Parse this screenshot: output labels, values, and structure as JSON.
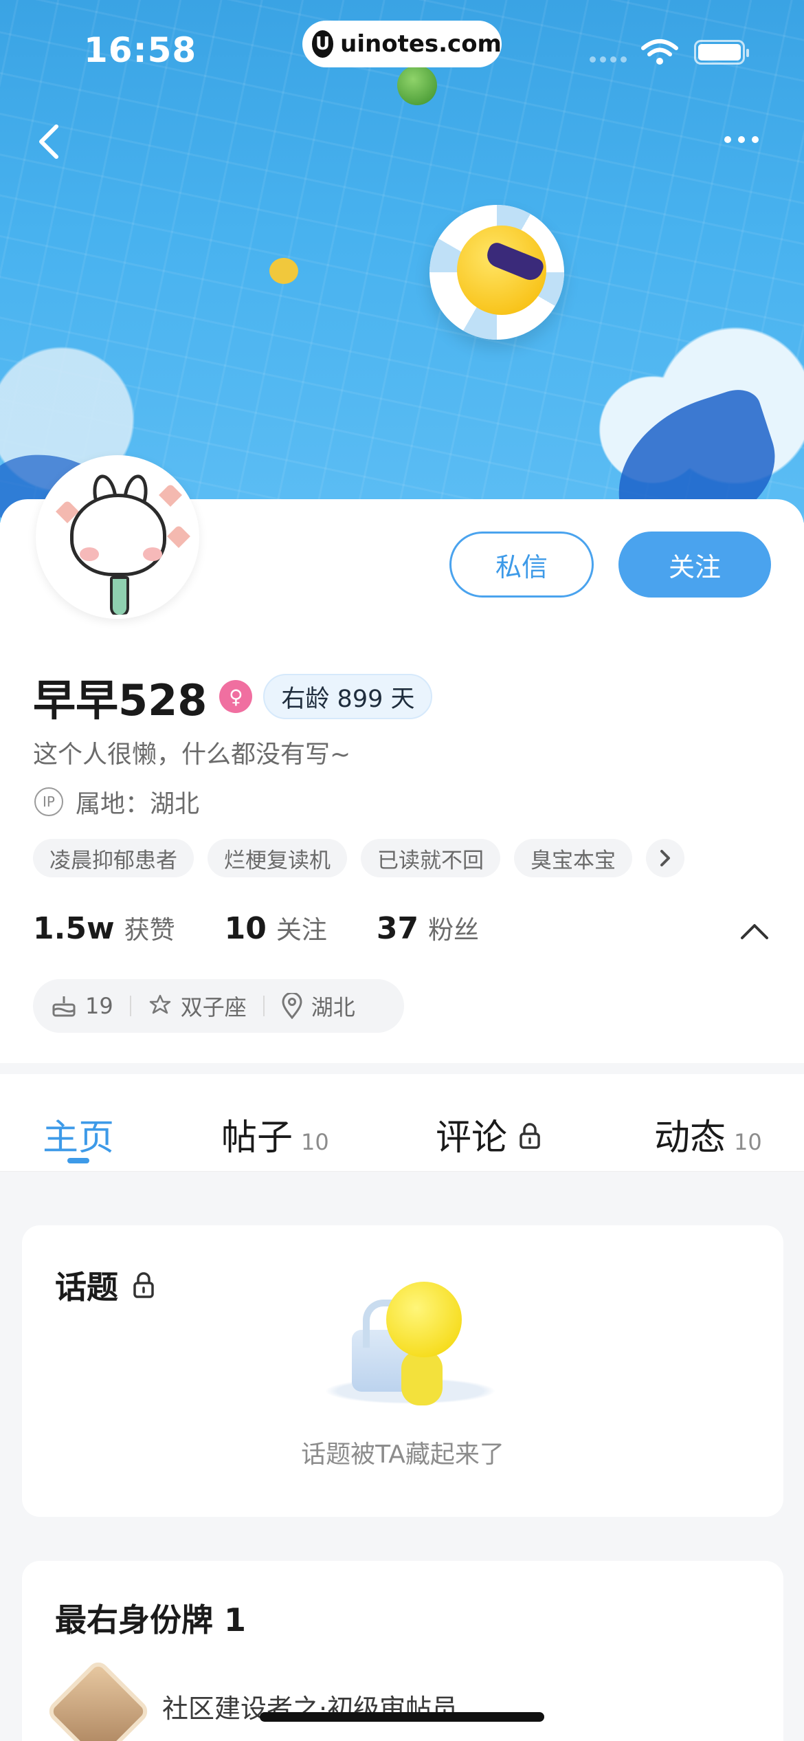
{
  "status_bar": {
    "time": "16:58",
    "url": "uinotes.com",
    "url_icon": "U"
  },
  "profile": {
    "username": "早早528",
    "gender_badge": "♀",
    "account_age": "右龄 899 天",
    "bio": "这个人很懒，什么都没有写~",
    "ip_icon_text": "IP",
    "ip_location": "属地：湖北",
    "tags": [
      "凌晨抑郁患者",
      "烂梗复读机",
      "已读就不回",
      "臭宝本宝"
    ],
    "stats": [
      {
        "num": "1.5w",
        "label": "获赞"
      },
      {
        "num": "10",
        "label": "关注"
      },
      {
        "num": "37",
        "label": "粉丝"
      }
    ],
    "info": {
      "age": "19",
      "zodiac": "双子座",
      "region": "湖北"
    }
  },
  "actions": {
    "message_label": "私信",
    "follow_label": "关注"
  },
  "tabs": [
    {
      "label": "主页",
      "count": ""
    },
    {
      "label": "帖子",
      "count": "10"
    },
    {
      "label": "评论",
      "count": ""
    },
    {
      "label": "动态",
      "count": "10"
    }
  ],
  "topic_card": {
    "title": "话题",
    "empty_text": "话题被TA藏起来了"
  },
  "badge_card": {
    "title": "最右身份牌 1",
    "badge_name": "社区建设者之·初级审帖员"
  },
  "colors": {
    "accent": "#3d9ae8",
    "banner": "#48b2ef",
    "gender": "#f06fa0"
  },
  "icons": [
    "back-icon",
    "more-icon",
    "wifi-icon",
    "battery-icon",
    "lock-icon",
    "cake-icon",
    "zodiac-icon",
    "location-icon",
    "chevron-right-icon",
    "chevron-up-icon"
  ]
}
